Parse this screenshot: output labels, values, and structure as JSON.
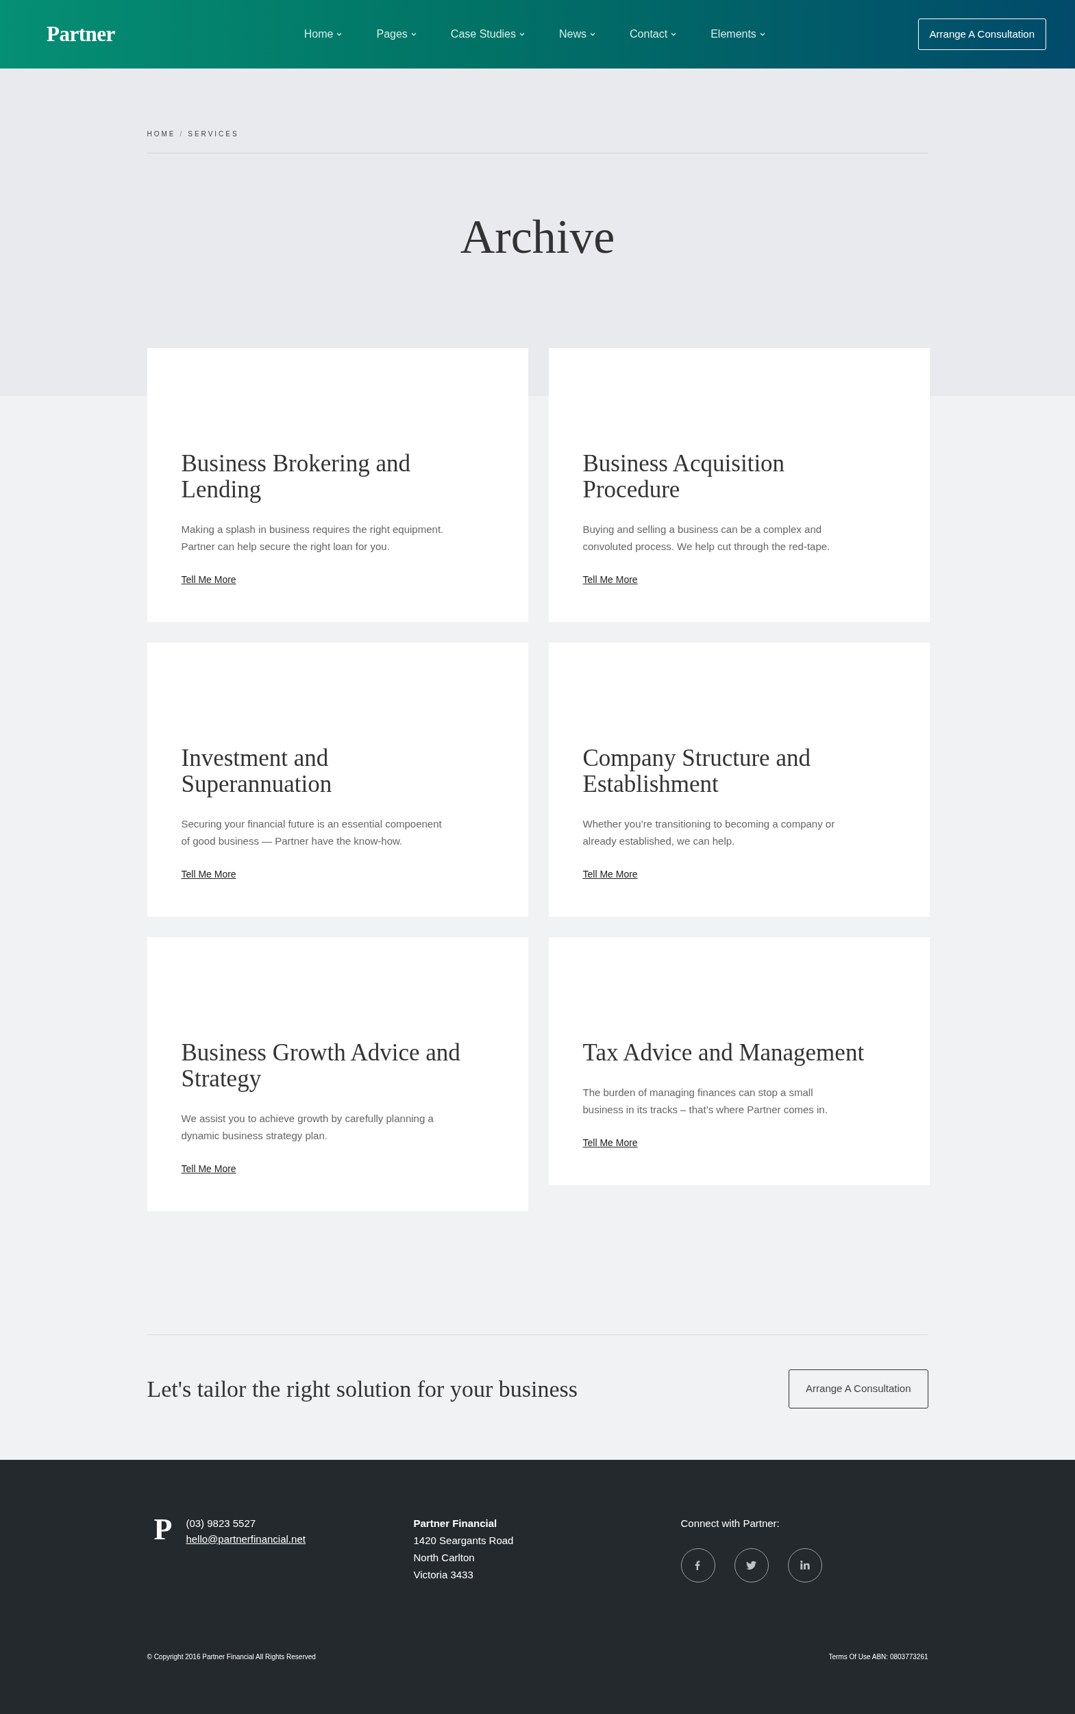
{
  "navbar": {
    "brand": "Partner",
    "items": [
      {
        "label": "Home",
        "dropdown": true
      },
      {
        "label": "Pages",
        "dropdown": true
      },
      {
        "label": "Case Studies",
        "dropdown": true
      },
      {
        "label": "News",
        "dropdown": true
      },
      {
        "label": "Contact",
        "dropdown": true
      },
      {
        "label": "Elements",
        "dropdown": true
      }
    ],
    "button": "Arrange A Consultation"
  },
  "breadcrumb": {
    "items": [
      "HOME",
      "SERVICES"
    ],
    "separator": "/"
  },
  "title": "Archive",
  "services": [
    {
      "title": "Business Brokering and Lending",
      "text": "Making a splash in business requires the right equipment. Partner can help secure the right loan for you.",
      "link": "Tell Me More"
    },
    {
      "title": "Business Acquisition Procedure",
      "text": "Buying and selling a business can be a complex and convoluted process. We help cut through the red-tape.",
      "link": "Tell Me More"
    },
    {
      "title": "Investment and Superannuation",
      "text": "Securing your financial future is an essential compoenent of good business — Partner have the know-how.",
      "link": "Tell Me More"
    },
    {
      "title": "Company Structure and Establishment",
      "text": "Whether you’re transitioning to becoming a company or already established, we can help.",
      "link": "Tell Me More"
    },
    {
      "title": "Business Growth Advice and Strategy",
      "text": "We assist you to achieve growth by carefully planning a dynamic business strategy plan.",
      "link": "Tell Me More"
    },
    {
      "title": "Tax Advice and Management",
      "text": "The burden of managing finances can stop a small business in its tracks – that’s where Partner comes in.",
      "link": "Tell Me More"
    }
  ],
  "cta": {
    "text": "Let's tailor the right solution for your business",
    "button": "Arrange A Consultation"
  },
  "footer": {
    "logo": "P",
    "phone": "(03) 9823 5527",
    "email": "hello@partnerfinancial.net",
    "address": [
      "Partner Financial",
      "1420 Seargants Road",
      "North Carlton",
      "Victoria 3433"
    ],
    "connect": "Connect with Partner:",
    "social": [
      {
        "kind": "facebook"
      },
      {
        "kind": "twitter"
      },
      {
        "kind": "linkedin"
      }
    ],
    "copyright": "© Copyright 2016 Partner Financial All Rights Reserved",
    "legal": "Terms Of Use ABN: 0803773261"
  }
}
